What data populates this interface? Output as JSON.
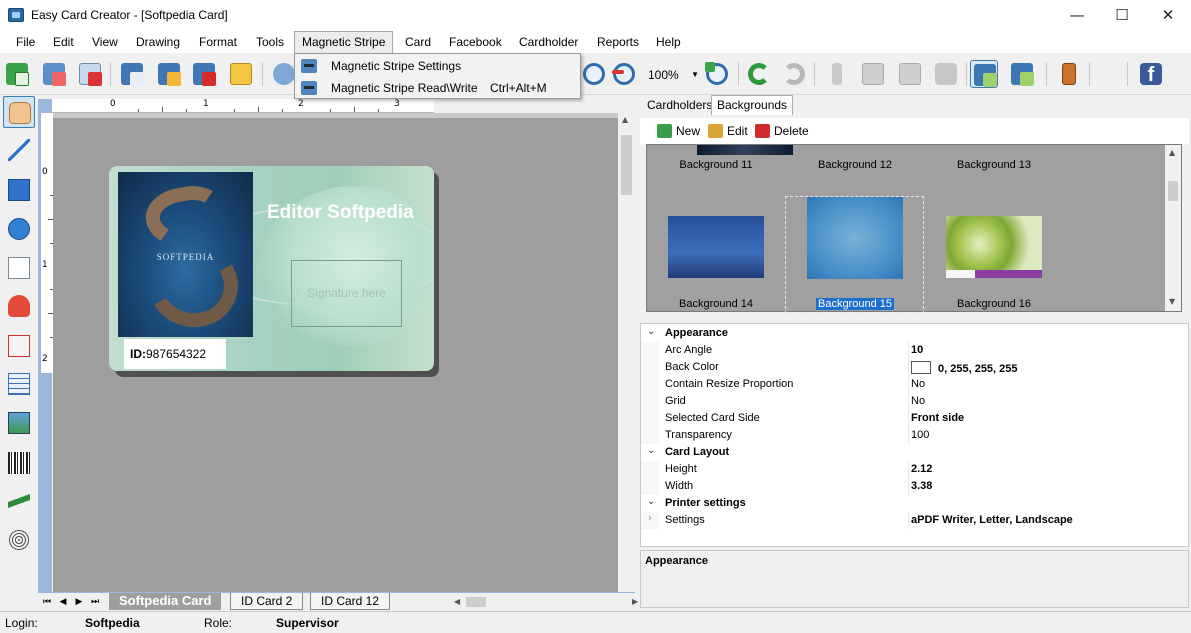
{
  "window": {
    "title": "Easy Card Creator - [Softpedia Card]",
    "minimize_glyph": "—",
    "maximize_glyph": "☐",
    "close_glyph": "✕"
  },
  "menu": {
    "items": [
      "File",
      "Edit",
      "View",
      "Drawing",
      "Format",
      "Tools",
      "Magnetic Stripe",
      "Card",
      "Facebook",
      "Cardholder",
      "Reports",
      "Help"
    ],
    "open_item": "Magnetic Stripe"
  },
  "dropdown": {
    "items": [
      {
        "label": "Magnetic Stripe Settings",
        "shortcut": "",
        "icon": "magnetic-stripe-settings-icon"
      },
      {
        "label": "Magnetic Stripe Read\\Write",
        "shortcut": "Ctrl+Alt+M",
        "icon": "magnetic-stripe-readwrite-icon"
      }
    ]
  },
  "toolbar": {
    "zoom_value": "100%",
    "zoom_arrow": "▼",
    "icons": [
      "new-card-icon",
      "card-properties-icon",
      "delete-card-icon",
      "add-item-icon",
      "edit-item-icon",
      "remove-item-icon",
      "open-folder-icon",
      "settings-icon",
      "zoom-in-icon",
      "zoom-out-icon",
      "zoom-fit-icon",
      "undo-icon",
      "redo-icon",
      "cut-icon",
      "copy-icon",
      "paste-icon",
      "delete-icon",
      "front-side-icon",
      "back-side-icon",
      "exit-door-icon",
      "facebook-icon"
    ],
    "facebook_glyph": "f"
  },
  "left_tools": [
    "pointer-hand-icon",
    "line-tool-icon",
    "rectangle-tool-icon",
    "ellipse-tool-icon",
    "text-tool-icon",
    "cardholder-photo-icon",
    "data-field-icon",
    "table-tool-icon",
    "image-tool-icon",
    "barcode-tool-icon",
    "signature-tool-icon",
    "fingerprint-tool-icon"
  ],
  "ruler": {
    "top_numbers": [
      "0",
      "1",
      "2",
      "3"
    ],
    "left_numbers": [
      "0",
      "1",
      "2"
    ]
  },
  "card": {
    "name_text": "Editor Softpedia",
    "signature_placeholder": "Signature here",
    "id_label": "ID:",
    "id_value": "987654322",
    "photo_brand": "SOFTPEDIA"
  },
  "sheets": {
    "nav_first": "⏮",
    "nav_prev": "◀",
    "nav_next": "▶",
    "nav_last": "⏭",
    "tabs": [
      "Softpedia Card",
      "ID Card 2",
      "ID Card 12"
    ],
    "active": "Softpedia Card"
  },
  "right_panel": {
    "tabs": [
      "Cardholders",
      "Backgrounds"
    ],
    "active_tab": "Backgrounds",
    "bg_buttons": [
      "New",
      "Edit",
      "Delete"
    ],
    "backgrounds": [
      {
        "label": "Background 11"
      },
      {
        "label": "Background 12"
      },
      {
        "label": "Background 13"
      },
      {
        "label": "Background 14"
      },
      {
        "label": "Background 15",
        "selected": true
      },
      {
        "label": "Background 16"
      }
    ]
  },
  "properties": {
    "rows": [
      {
        "type": "category",
        "name": "Appearance",
        "chevron": "⌄"
      },
      {
        "type": "prop",
        "name": "Arc Angle",
        "value": "10",
        "bold": true
      },
      {
        "type": "prop",
        "name": "Back Color",
        "value": "0, 255, 255, 255",
        "bold": true,
        "swatch": true
      },
      {
        "type": "prop",
        "name": "Contain Resize Proportion",
        "value": "No",
        "bold": false
      },
      {
        "type": "prop",
        "name": "Grid",
        "value": "No",
        "bold": false
      },
      {
        "type": "prop",
        "name": "Selected Card Side",
        "value": "Front side",
        "bold": true
      },
      {
        "type": "prop",
        "name": "Transparency",
        "value": "100",
        "bold": false
      },
      {
        "type": "category",
        "name": "Card Layout",
        "chevron": "⌄"
      },
      {
        "type": "prop",
        "name": "Height",
        "value": "2.12",
        "bold": true
      },
      {
        "type": "prop",
        "name": "Width",
        "value": "3.38",
        "bold": true
      },
      {
        "type": "category",
        "name": "Printer settings",
        "chevron": "⌄"
      },
      {
        "type": "prop",
        "name": "Settings",
        "value": "aPDF Writer, Letter, Landscape",
        "bold": true,
        "expander": "›"
      }
    ],
    "description_title": "Appearance"
  },
  "status": {
    "login_label": "Login:",
    "login_value": "Softpedia",
    "role_label": "Role:",
    "role_value": "Supervisor"
  },
  "colors": {
    "accent": "#3c7fb1",
    "selection": "#1f6fcf",
    "canvas": "#9e9e9e",
    "ruler_frame": "#9bb7dd"
  }
}
